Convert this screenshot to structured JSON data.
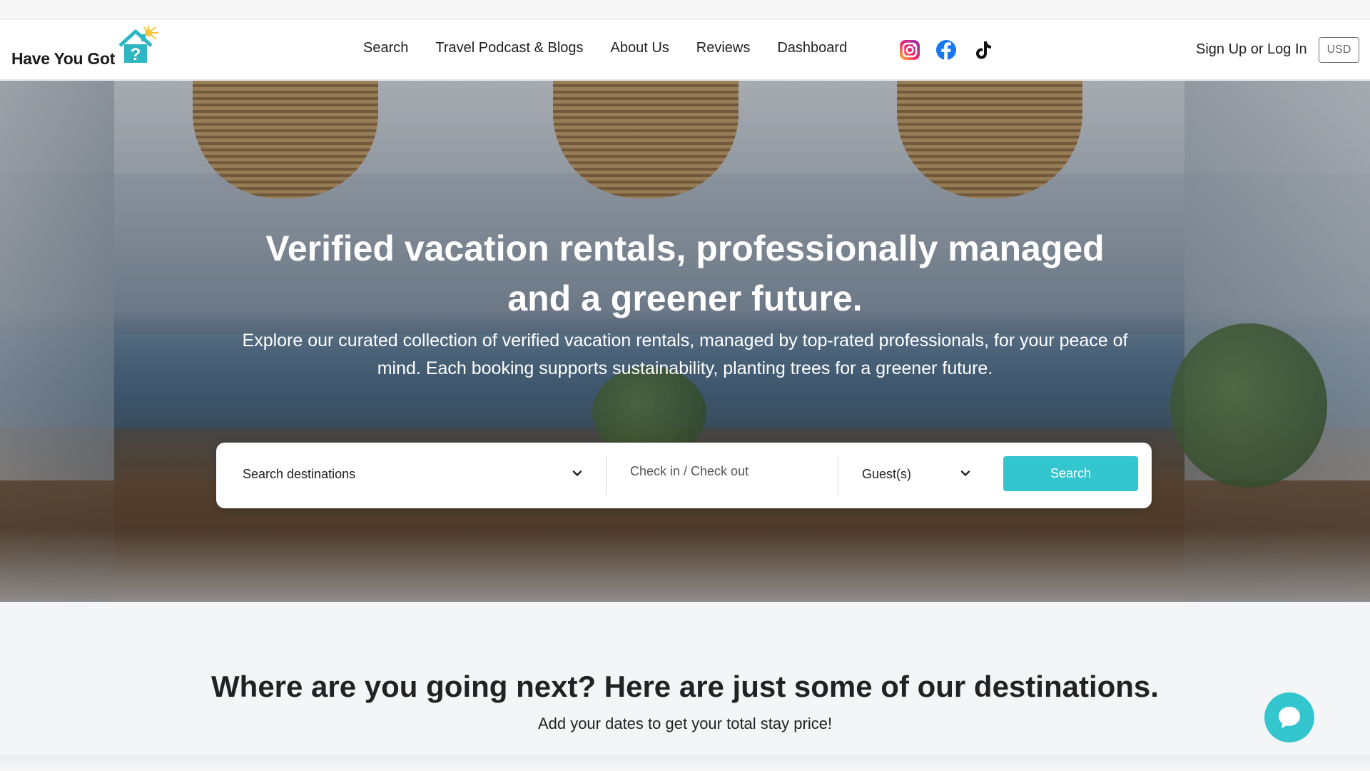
{
  "brand": {
    "name": "Have You Got",
    "colors": {
      "accent": "#33c6cf",
      "logo_house": "#2fb6c3",
      "logo_sun": "#f6c33b"
    }
  },
  "nav": {
    "items": [
      {
        "label": "Search"
      },
      {
        "label": "Travel Podcast & Blogs"
      },
      {
        "label": "About Us"
      },
      {
        "label": "Reviews"
      },
      {
        "label": "Dashboard"
      }
    ],
    "social": [
      "instagram-icon",
      "facebook-icon",
      "tiktok-icon"
    ],
    "signup_label": "Sign Up or Log In",
    "currency": "USD"
  },
  "hero": {
    "title_line1": "Verified vacation rentals, professionally managed",
    "title_line2": "and a greener future.",
    "subtitle_line1": "Explore our curated collection of verified vacation rentals, managed by top-rated professionals, for your peace of",
    "subtitle_line2": "mind. Each booking supports sustainability, planting trees for a greener future."
  },
  "search": {
    "destination_placeholder": "Search destinations",
    "dates_placeholder": "Check in / Check out",
    "guests_label": "Guest(s)",
    "button_label": "Search"
  },
  "destinations": {
    "title": "Where are you going next? Here are just some of our destinations.",
    "subtitle": "Add your dates to get your total stay price!"
  },
  "chat": {
    "icon": "chat-bubble-icon"
  }
}
